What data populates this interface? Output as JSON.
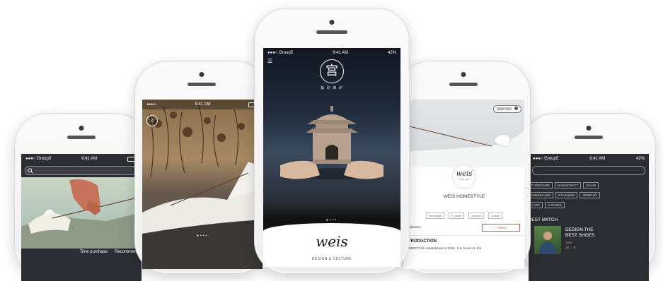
{
  "phones": {
    "p1": {
      "status": {
        "carrier": "●●●○ Group5",
        "time": "9:41 AM"
      },
      "bottom": {
        "left": "Time purchase",
        "right": "Recommend"
      }
    },
    "p2": {
      "status": {
        "time": "9:41 AM"
      },
      "pager_dots": "●•••"
    },
    "p3": {
      "status": {
        "carrier": "●●●○ Group5",
        "time": "9:41 AM",
        "battery": "42%"
      },
      "menu_icon": "☰",
      "seal_char": "宫",
      "seal_sub": "紫 砂 西 炉",
      "pager_dots": "●•••",
      "brand": "weis",
      "tagline": "DESIGN & CULTURE"
    },
    "p4": {
      "badge": "SAM WEI",
      "brand": "weis",
      "brand_sub": "home style",
      "title": "WEIS HOMESTYLE",
      "tags": [
        "homestyle",
        "F power",
        "ceramic",
        "culture"
      ],
      "followers": "48 followers",
      "follow_button": "+ follow",
      "section": "INTRODUCTION",
      "intro": "HOMESTYLE established in 2011. It is focus on the"
    },
    "p5": {
      "status": {
        "carrier": "●●●○ Group5",
        "time": "9:41 AM",
        "battery": "42%"
      },
      "tags_row1": [
        "FURNITURE",
        "HANDICRAFT",
        "CHAIR"
      ],
      "tags_row2": [
        "MINIMALISM",
        "# FASHION",
        "JEWELRY"
      ],
      "tags_row3": [
        "# ART",
        "# SHOES"
      ],
      "section": "BEST MATCH",
      "card_title": "DESIGN THE BEST SHOES",
      "card_author": "Jane",
      "card_count": "22 ♡ 8"
    }
  },
  "colors": {
    "dark_ui": "#2b2d33",
    "follow_red": "#e0505a",
    "paper": "#f6f4ef"
  }
}
